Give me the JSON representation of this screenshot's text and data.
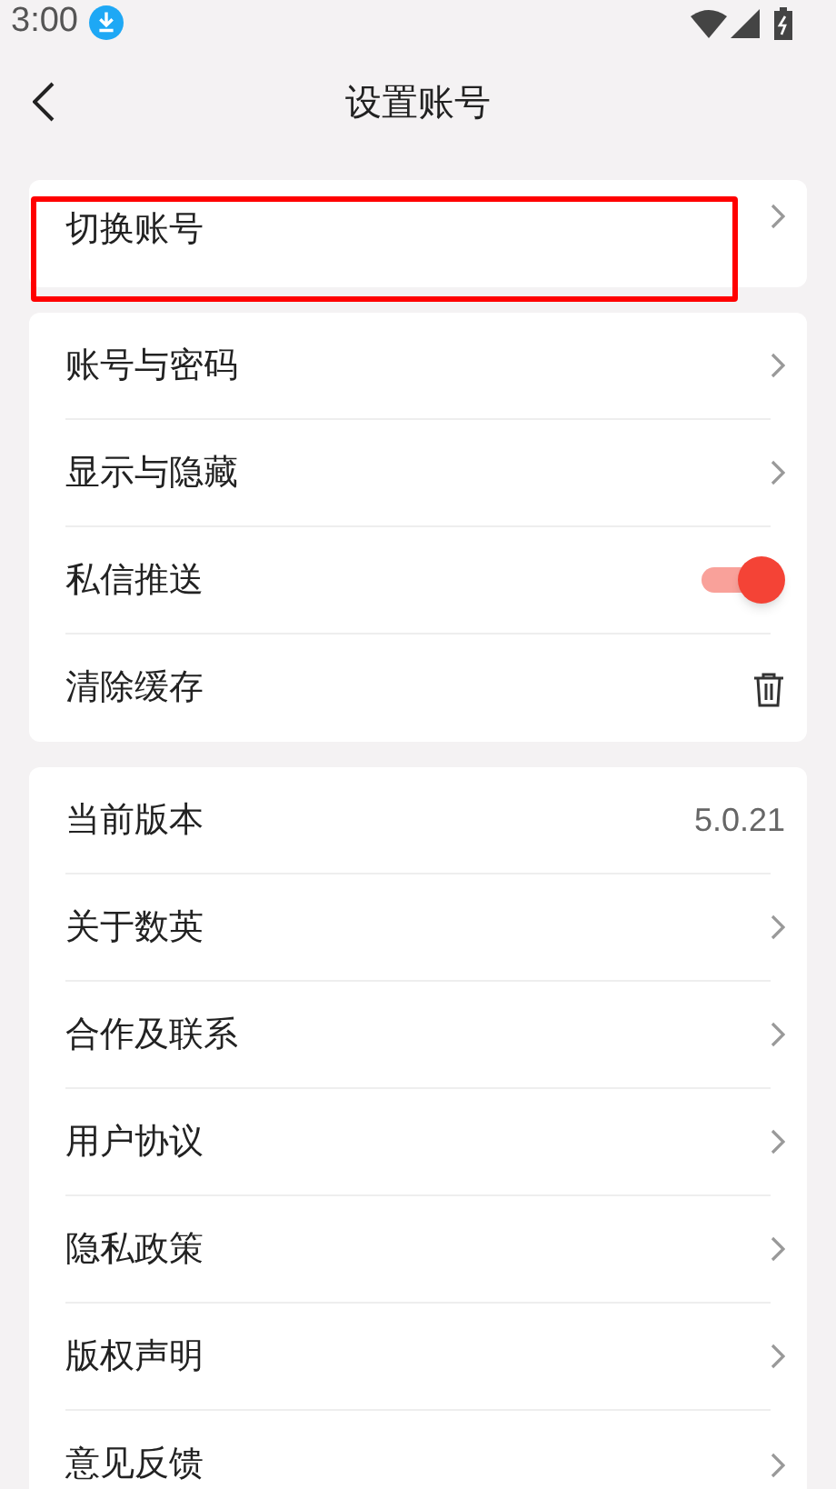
{
  "status_bar": {
    "time": "3:00"
  },
  "header": {
    "title": "设置账号"
  },
  "groups": [
    {
      "items": [
        {
          "kind": "link",
          "label": "切换账号",
          "highlighted": true
        }
      ]
    },
    {
      "items": [
        {
          "kind": "link",
          "label": "账号与密码",
          "highlighted": false
        },
        {
          "kind": "link",
          "label": "显示与隐藏",
          "highlighted": false
        },
        {
          "kind": "toggle",
          "label": "私信推送",
          "on": true,
          "highlighted": false
        },
        {
          "kind": "trash",
          "label": "清除缓存",
          "highlighted": false
        }
      ]
    },
    {
      "items": [
        {
          "kind": "value",
          "label": "当前版本",
          "value": "5.0.21",
          "highlighted": false
        },
        {
          "kind": "link",
          "label": "关于数英",
          "highlighted": false
        },
        {
          "kind": "link",
          "label": "合作及联系",
          "highlighted": false
        },
        {
          "kind": "link",
          "label": "用户协议",
          "highlighted": false
        },
        {
          "kind": "link",
          "label": "隐私政策",
          "highlighted": false
        },
        {
          "kind": "link",
          "label": "版权声明",
          "highlighted": false
        },
        {
          "kind": "link",
          "label": "意见反馈",
          "highlighted": false
        }
      ]
    }
  ]
}
